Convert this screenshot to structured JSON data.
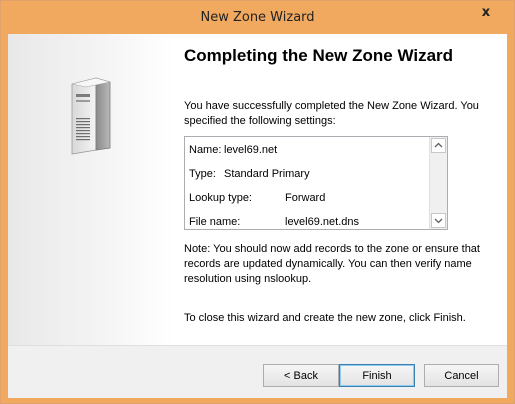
{
  "window": {
    "title": "New Zone Wizard",
    "close_glyph": "x"
  },
  "wizard": {
    "heading": "Completing the New Zone Wizard",
    "intro": "You have successfully completed the New Zone Wizard. You specified the following settings:",
    "settings": [
      {
        "label": "Name:",
        "value": "level69.net"
      },
      {
        "label": "Type:",
        "value": "Standard Primary"
      },
      {
        "label": "Lookup type:",
        "value": "Forward"
      },
      {
        "label": "File name:",
        "value": "level69.net.dns"
      }
    ],
    "note": "Note: You should now add records to the zone or ensure that records are updated dynamically. You can then verify name resolution using nslookup.",
    "close_instruction": "To close this wizard and create the new zone, click Finish."
  },
  "buttons": {
    "back": "< Back",
    "finish": "Finish",
    "cancel": "Cancel"
  },
  "colors": {
    "titlebar": "#f0a95e",
    "default_button_border": "#3c7fb1"
  },
  "icons": {
    "left_panel": "server-tower-icon",
    "scroll_up": "chevron-up-icon",
    "scroll_down": "chevron-down-icon"
  }
}
